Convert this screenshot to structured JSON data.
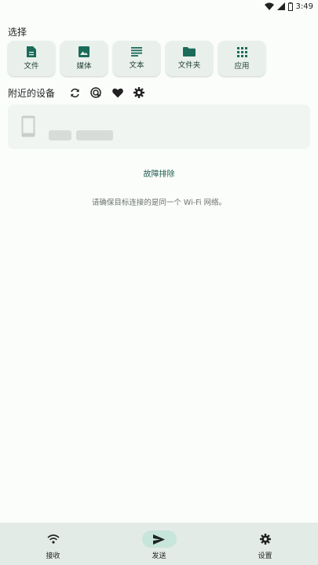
{
  "status_bar": {
    "time": "3:49"
  },
  "select_section": {
    "title": "选择",
    "buttons": [
      {
        "label": "文件",
        "icon": "file-icon"
      },
      {
        "label": "媒体",
        "icon": "image-icon"
      },
      {
        "label": "文本",
        "icon": "text-icon"
      },
      {
        "label": "文件夹",
        "icon": "folder-icon"
      },
      {
        "label": "应用",
        "icon": "apps-grid-icon"
      }
    ]
  },
  "nearby_section": {
    "title": "附近的设备",
    "actions": [
      "refresh-icon",
      "scan-target-icon",
      "favorite-heart-icon",
      "settings-gear-icon"
    ]
  },
  "troubleshoot_link": "故障排除",
  "network_hint": "请确保目标连接的是同一个 Wi-Fi 网络。",
  "bottom_nav": {
    "items": [
      {
        "label": "接收",
        "icon": "wifi-receive-icon"
      },
      {
        "label": "发送",
        "icon": "send-icon",
        "active": true
      },
      {
        "label": "设置",
        "icon": "settings-gear-icon"
      }
    ]
  },
  "colors": {
    "accent": "#1b6b59",
    "button_bg": "#e9f0ec",
    "nav_bg": "#e3ebe6",
    "nav_active": "#c8e5db"
  }
}
